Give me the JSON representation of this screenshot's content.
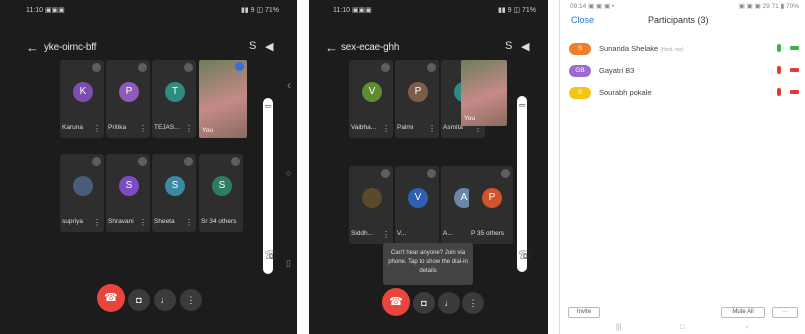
{
  "screen1": {
    "status_left": "11:10 ▣▣▣",
    "status_right": "▮▮ 9 ◫ 71%",
    "meeting_code": "yke-oirnc-bff",
    "tiles": [
      {
        "initial": "K",
        "name": "Karuna",
        "color": "#7a4fb0"
      },
      {
        "initial": "P",
        "name": "Pritika",
        "color": "#8f5ab8"
      },
      {
        "initial": "T",
        "name": "TEJAS...",
        "color": "#2f8d7e"
      },
      {
        "initial": "",
        "name": "supriya",
        "color": "#4a5c7a"
      },
      {
        "initial": "S",
        "name": "Shravani",
        "color": "#7c4cc2"
      },
      {
        "initial": "S",
        "name": "Sheeta",
        "color": "#3a8aa5"
      },
      {
        "initial": "S",
        "name": "Sr 34 others",
        "color": "#2e7d60"
      }
    ],
    "self_label": "You"
  },
  "screen2": {
    "status_left": "11:10 ▣▣▣",
    "status_right": "▮▮ 9 ◫ 71%",
    "meeting_code": "sex-ecae-ghh",
    "tiles": [
      {
        "initial": "V",
        "name": "Vaibha...",
        "color": "#5f8c31"
      },
      {
        "initial": "P",
        "name": "Palmi",
        "color": "#7d5c4a"
      },
      {
        "initial": "A",
        "name": "Asmita",
        "color": "#2b8b86"
      },
      {
        "initial": "",
        "name": "Siddh...",
        "color": "#5a4a2a"
      },
      {
        "initial": "V",
        "name": "V...",
        "color": "#2f5fb5"
      },
      {
        "initial": "A",
        "name": "A...",
        "color": "#6c86a8"
      },
      {
        "initial": "P",
        "name": "P 35 others",
        "color": "#d0532a"
      }
    ],
    "self_label": "You",
    "toast": "Can't hear anyone? Join via phone. Tap to show the dial-in details"
  },
  "participants": {
    "status_left": "09:14 ▣ ▣ ▣ •",
    "status_right": "▣ ▣ ▣ 29 71 ▮ 70%",
    "close_label": "Close",
    "title": "Participants (3)",
    "rows": [
      {
        "initials": "S",
        "name": "Sunanda Shelake",
        "host_tag": "(Host, me)",
        "color": "#f07d2a",
        "mic_color": "#3ab54a"
      },
      {
        "initials": "GB",
        "name": "Gayatri B3",
        "host_tag": "",
        "color": "#9b6bd2",
        "mic_color": "#e53935"
      },
      {
        "initials": "S",
        "name": "Sourabh pokale",
        "host_tag": "",
        "color": "#f3c51b",
        "mic_color": "#e53935"
      }
    ],
    "invite_label": "Invite",
    "mute_all_label": "Mute All",
    "more_label": "···"
  }
}
